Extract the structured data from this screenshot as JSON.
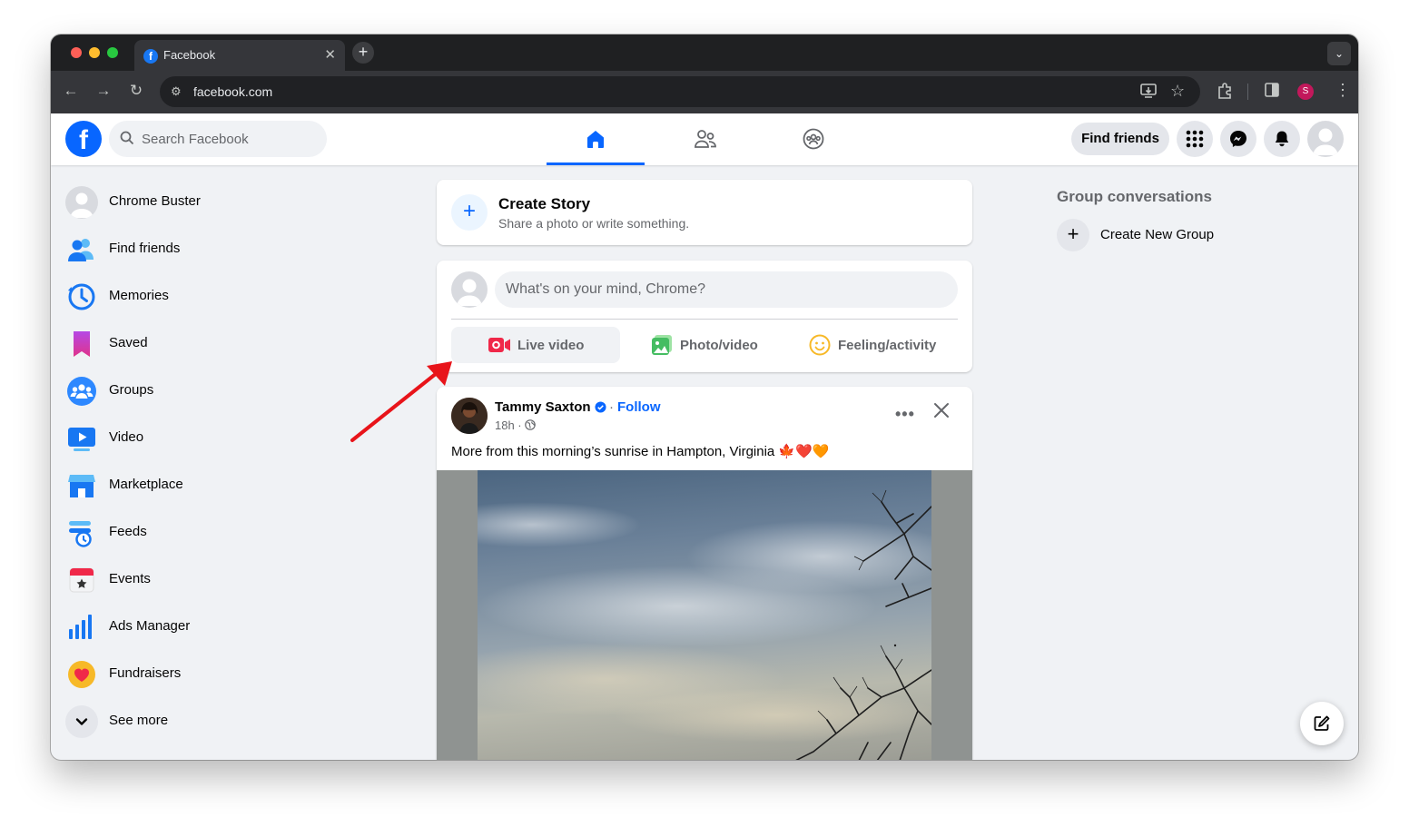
{
  "browser": {
    "tab_title": "Facebook",
    "tab_close": "✕",
    "new_tab": "+",
    "tab_menu": "⌄",
    "url": "facebook.com",
    "profile_initial": "S"
  },
  "header": {
    "search_placeholder": "Search Facebook",
    "find_friends": "Find friends"
  },
  "sidebar": {
    "items": [
      {
        "label": "Chrome Buster",
        "icon": "profile-avatar"
      },
      {
        "label": "Find friends",
        "icon": "friends-icon"
      },
      {
        "label": "Memories",
        "icon": "memories-icon"
      },
      {
        "label": "Saved",
        "icon": "saved-icon"
      },
      {
        "label": "Groups",
        "icon": "groups-icon"
      },
      {
        "label": "Video",
        "icon": "video-icon"
      },
      {
        "label": "Marketplace",
        "icon": "marketplace-icon"
      },
      {
        "label": "Feeds",
        "icon": "feeds-icon"
      },
      {
        "label": "Events",
        "icon": "events-icon"
      },
      {
        "label": "Ads Manager",
        "icon": "ads-manager-icon"
      },
      {
        "label": "Fundraisers",
        "icon": "fundraisers-icon"
      },
      {
        "label": "See more",
        "icon": "chevron-down-icon"
      }
    ]
  },
  "story": {
    "title": "Create Story",
    "subtitle": "Share a photo or write something."
  },
  "composer": {
    "placeholder": "What's on your mind, Chrome?",
    "live_video": "Live video",
    "photo_video": "Photo/video",
    "feeling": "Feeling/activity"
  },
  "post": {
    "author": "Tammy Saxton",
    "separator": "·",
    "follow": "Follow",
    "time": "18h ·",
    "text": "More from this morning’s sunrise in Hampton, Virginia 🍁❤️🧡"
  },
  "right": {
    "group_conversations": "Group conversations",
    "create_new_group": "Create New Group"
  },
  "colors": {
    "facebook_blue": "#0866ff",
    "annotation_arrow": "#e8141a"
  }
}
